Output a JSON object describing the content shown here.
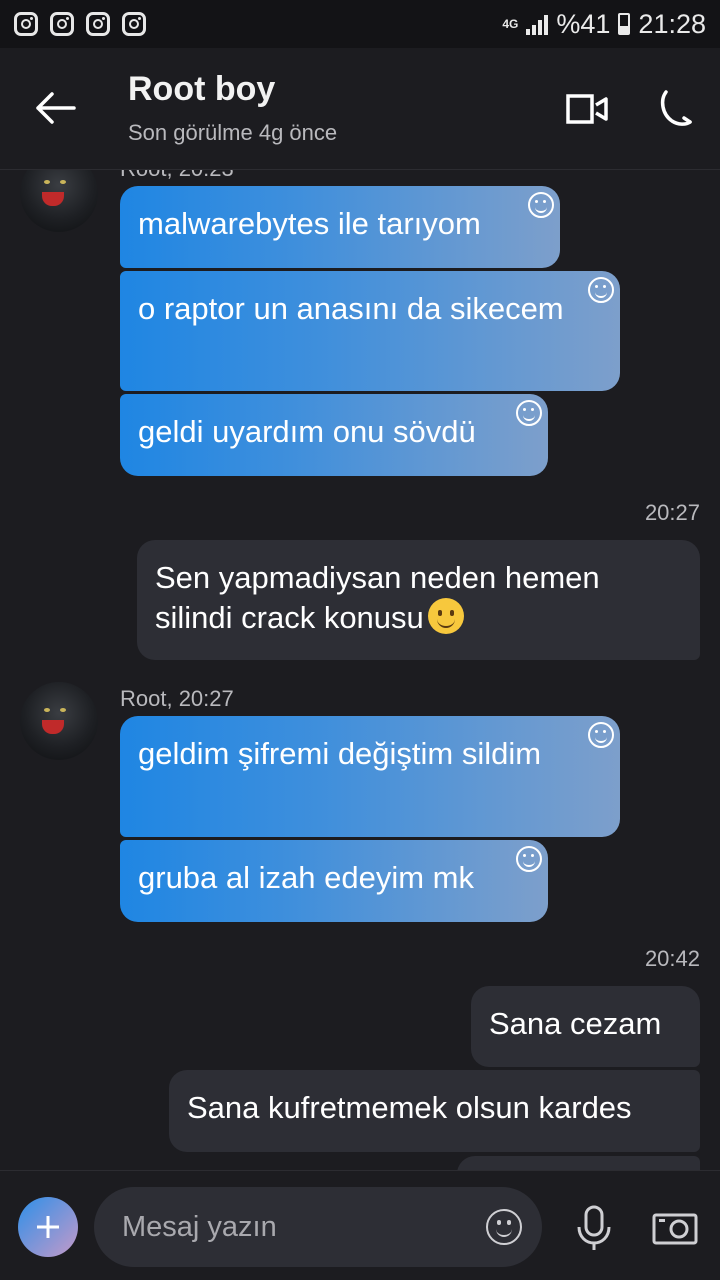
{
  "status_bar": {
    "network": "4G",
    "battery_percent": "%41",
    "time": "21:28",
    "notification_icons": [
      "instagram-icon",
      "instagram-icon",
      "instagram-icon",
      "instagram-icon"
    ]
  },
  "header": {
    "contact_name": "Root boy",
    "last_seen": "Son görülme 4g önce"
  },
  "messages": {
    "group1": {
      "sender_partial": "Root, 20:23",
      "items": [
        "malwarebytes ile tarıyom",
        "o raptor un anasını da sikecem",
        "geldi uyardım onu sövdü"
      ]
    },
    "out1": {
      "time": "20:27",
      "text": "Sen yapmadiysan neden hemen silindi crack konusu"
    },
    "group2": {
      "sender": "Root, 20:27",
      "items": [
        "geldim şifremi değiştim sildim",
        "gruba al izah edeyim mk"
      ]
    },
    "out2": {
      "time": "20:42",
      "items": [
        "Sana cezam",
        "Sana kufretmemek olsun kardes"
      ]
    }
  },
  "composer": {
    "placeholder": "Mesaj yazın"
  },
  "colors": {
    "incoming_gradient_start": "#1f86e3",
    "incoming_gradient_end": "#7d9fcb",
    "outgoing_bubble": "#2d2e35",
    "background": "#1c1c20"
  }
}
